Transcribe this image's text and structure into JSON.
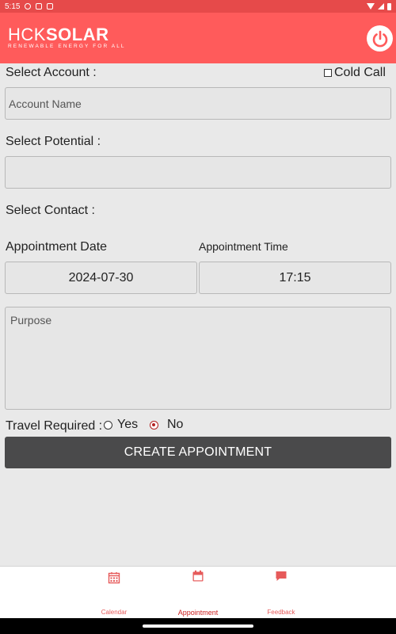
{
  "status_bar": {
    "time": "5:15"
  },
  "app_bar": {
    "logo_main_thin": "HCK",
    "logo_main_bold": "SOLAR",
    "logo_tagline": "RENEWABLE ENERGY FOR ALL",
    "power_icon": "power-icon",
    "accent_color": "#ff5b5b"
  },
  "form": {
    "select_account_label": "Select Account :",
    "cold_call_label": "Cold Call",
    "cold_call_checked": false,
    "account_name_placeholder": "Account Name",
    "select_potential_label": "Select Potential :",
    "potential_value": "",
    "select_contact_label": "Select Contact :",
    "appointment_date_label": "Appointment Date",
    "appointment_time_label": "Appointment Time",
    "appointment_date_value": "2024-07-30",
    "appointment_time_value": "17:15",
    "purpose_placeholder": "Purpose",
    "travel_required_label": "Travel Required :",
    "travel_options": [
      "Yes",
      "No"
    ],
    "travel_selected": "No",
    "create_button_label": "CREATE APPOINTMENT"
  },
  "bottom_nav": {
    "items": [
      {
        "label": "Calendar",
        "icon": "calendar-grid-icon",
        "active": false
      },
      {
        "label": "Appointment",
        "icon": "calendar-icon",
        "active": true
      },
      {
        "label": "Feedback",
        "icon": "chat-bubble-icon",
        "active": false
      }
    ]
  }
}
